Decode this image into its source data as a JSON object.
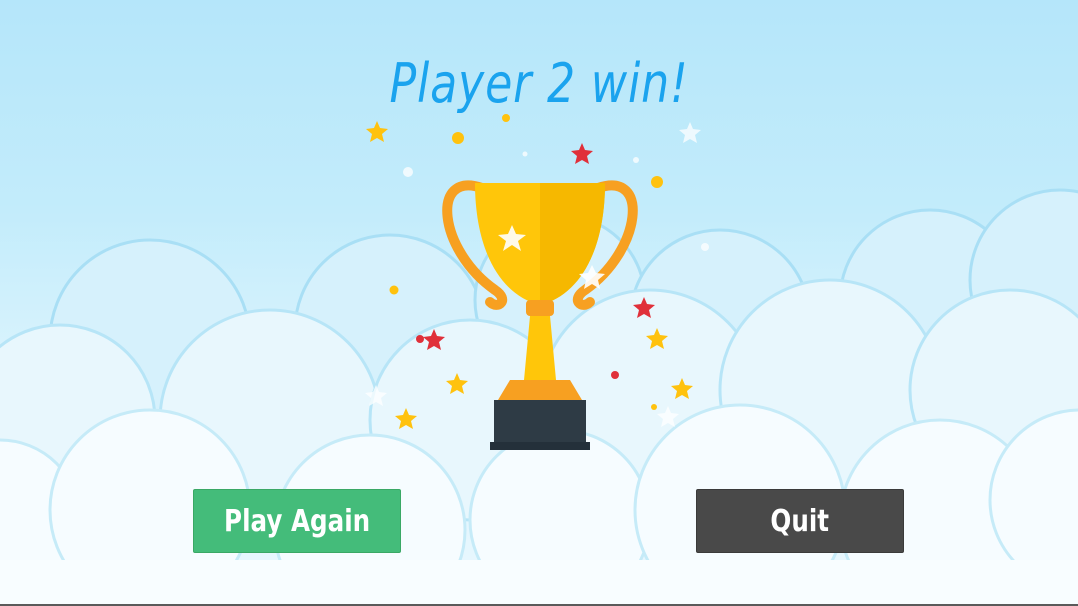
{
  "result": {
    "title": "Player 2 win!"
  },
  "buttons": {
    "play_again": "Play Again",
    "quit": "Quit"
  },
  "colors": {
    "title": "#1aa3ee",
    "play_again_bg": "#44bc7a",
    "quit_bg": "#494949",
    "trophy_gold": "#ffc60a",
    "trophy_orange": "#f7a021",
    "trophy_base": "#2e3b45",
    "star_red": "#e0303a",
    "star_gold": "#ffc20e"
  },
  "icons": {
    "trophy": "trophy-icon"
  }
}
